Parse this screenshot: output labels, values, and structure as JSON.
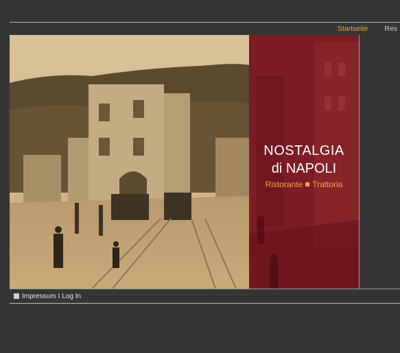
{
  "nav": {
    "items": [
      {
        "label": "Startseite",
        "active": true
      },
      {
        "label": "Res",
        "active": false
      }
    ]
  },
  "banner": {
    "line1": "NOSTALGIA",
    "line2": "di NAPOLI",
    "sub_left": "Ristorante",
    "sub_right": "Trattoria"
  },
  "footer": {
    "impressum": "Impressum",
    "separator": "I",
    "login": "Log In"
  },
  "colors": {
    "background": "#353535",
    "accent": "#f5a623",
    "burgundy": "#7c1c24"
  }
}
